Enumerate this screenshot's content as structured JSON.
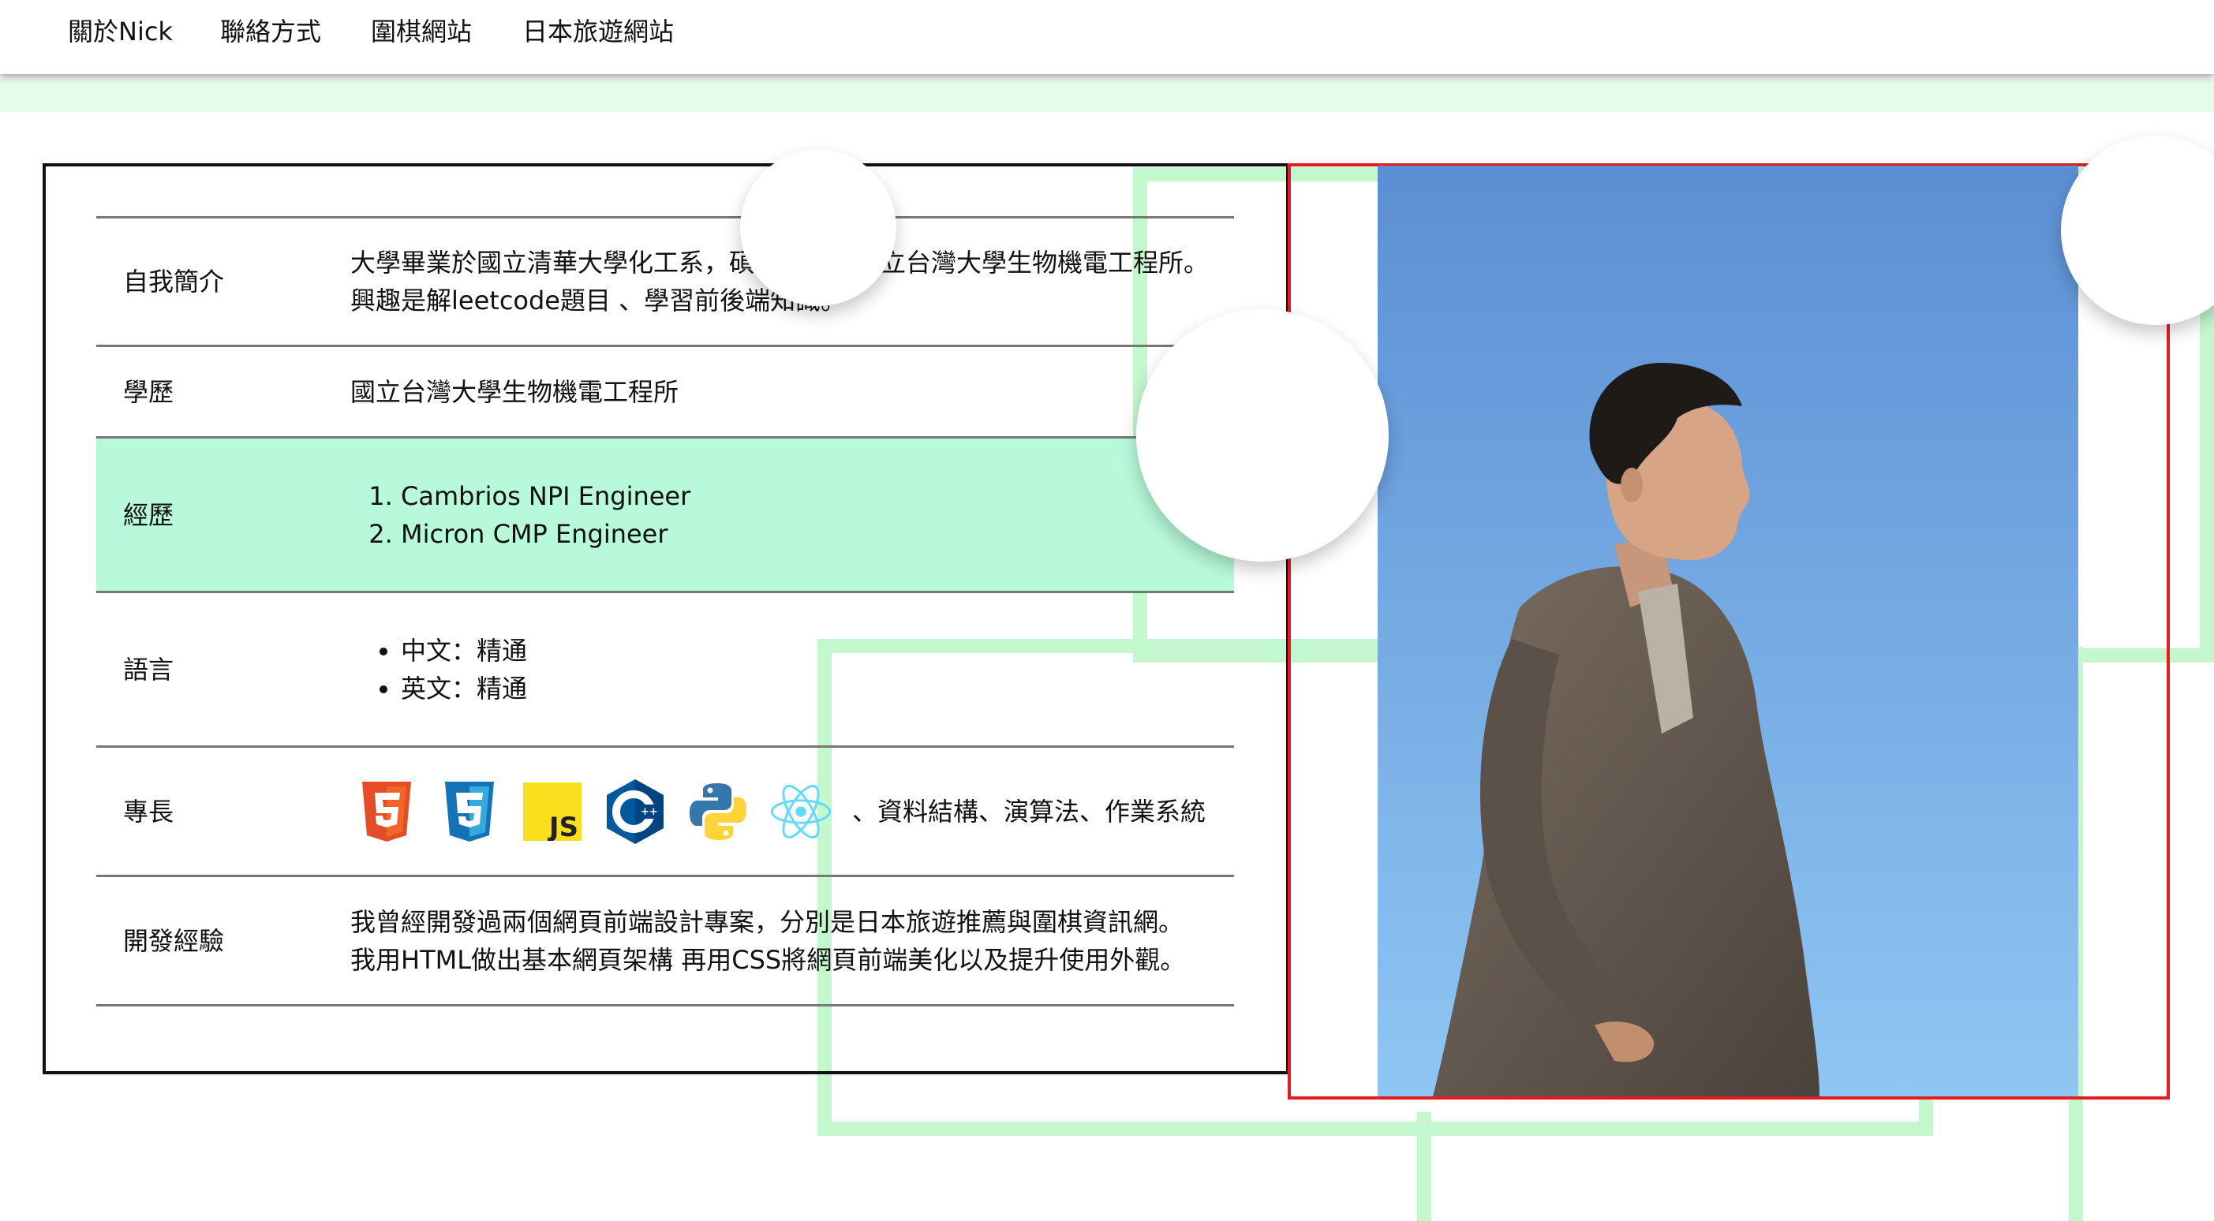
{
  "nav": {
    "items": [
      "關於Nick",
      "聯絡方式",
      "圍棋網站",
      "日本旅遊網站"
    ]
  },
  "profile": {
    "intro_label": "自我簡介",
    "intro_line1": "大學畢業於國立清華大學化工系，碩士畢業於國立台灣大學生物機電工程所。",
    "intro_line2": "興趣是解leetcode題目 、學習前後端知識。",
    "education_label": "學歷",
    "education_value": "國立台灣大學生物機電工程所",
    "experience_label": "經歷",
    "experience_items": [
      "Cambrios NPI Engineer",
      "Micron CMP Engineer"
    ],
    "language_label": "語言",
    "language_items": [
      "中文：精通",
      "英文：精通"
    ],
    "skills_label": "專長",
    "skills_icons": [
      "html5-icon",
      "css3-icon",
      "javascript-icon",
      "cplusplus-icon",
      "python-icon",
      "react-icon"
    ],
    "skills_js_text": "JS",
    "skills_text": "、資料結構、演算法、作業系統",
    "dev_label": "開發經驗",
    "dev_line1": "我曾經開發過兩個網頁前端設計專案，分別是日本旅遊推薦與圍棋資訊網。",
    "dev_line2": "我用HTML做出基本網頁架構 再用CSS將網頁前端美化以及提升使用外觀。"
  },
  "colors": {
    "accent_green": "#c3f8cf",
    "row_highlight": "#b7f9d8",
    "photo_border": "#e41b23",
    "sky_top": "#5b8fd3",
    "sky_bottom": "#8fc6f3"
  }
}
